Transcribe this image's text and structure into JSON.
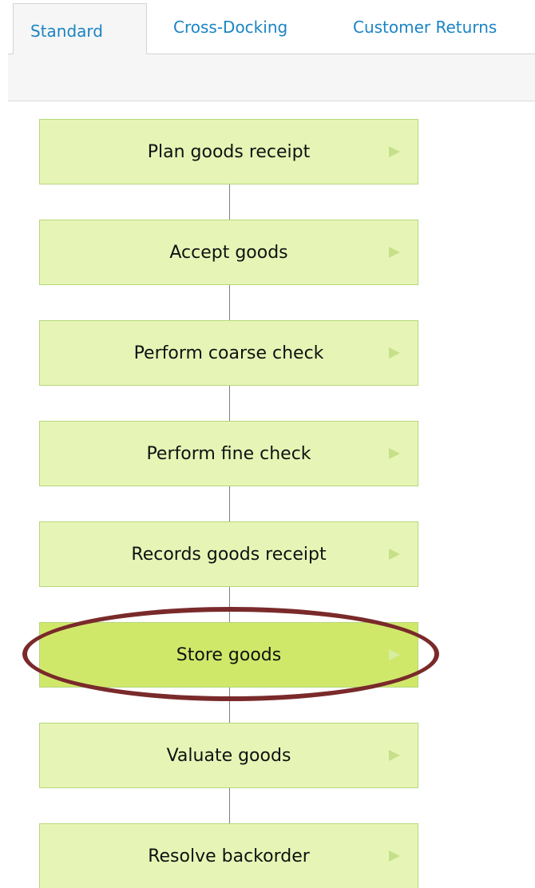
{
  "tabs": [
    {
      "label": "Standard",
      "active": true
    },
    {
      "label": "Cross-Docking",
      "active": false
    },
    {
      "label": "Customer Returns",
      "active": false
    }
  ],
  "steps": [
    {
      "label": "Plan goods receipt",
      "highlighted": false
    },
    {
      "label": "Accept goods",
      "highlighted": false
    },
    {
      "label": "Perform coarse check",
      "highlighted": false
    },
    {
      "label": "Perform fine check",
      "highlighted": false
    },
    {
      "label": "Records goods receipt",
      "highlighted": false
    },
    {
      "label": "Store goods",
      "highlighted": true
    },
    {
      "label": "Valuate goods",
      "highlighted": false
    },
    {
      "label": "Resolve backorder",
      "highlighted": false
    }
  ],
  "colors": {
    "tab_text": "#1b84c4",
    "step_fill": "#e6f5b6",
    "step_fill_highlight": "#d0e86a",
    "step_border": "#b6d77a",
    "arrow": "#c6e08a",
    "connector": "#7f7f7f",
    "annotation_ellipse": "#7a2a2a"
  },
  "icons": {
    "step_arrow": "play-arrow-icon"
  }
}
